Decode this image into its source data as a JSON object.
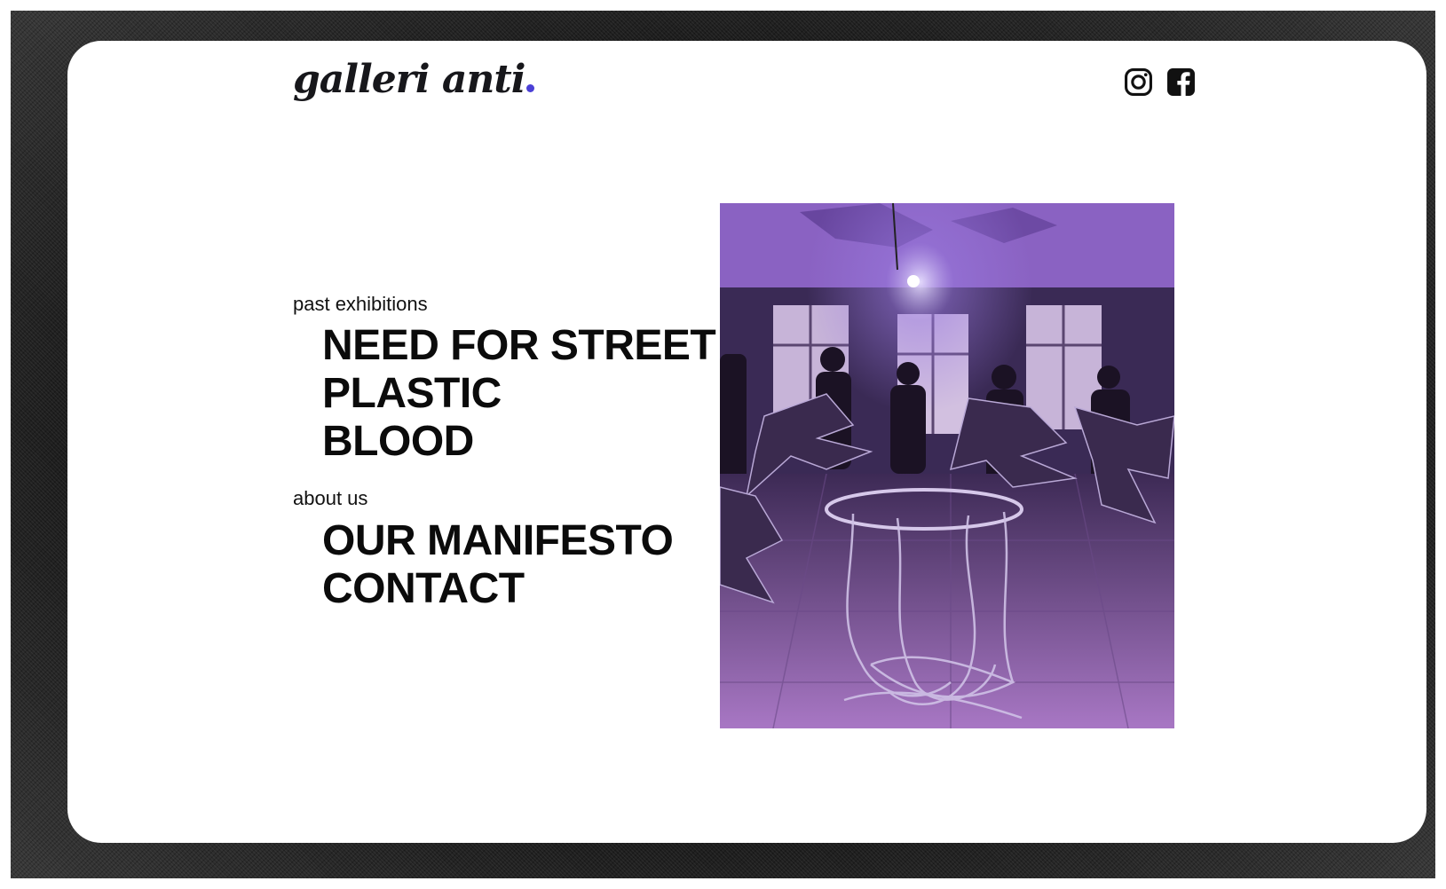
{
  "header": {
    "logo_text": "galleri anti",
    "social": [
      {
        "icon": "instagram-icon"
      },
      {
        "icon": "facebook-icon"
      }
    ]
  },
  "nav": {
    "past_exhibitions_label": "past exhibitions",
    "exhibitions": [
      "NEED FOR STREET",
      "PLASTIC",
      "BLOOD"
    ],
    "about_label": "about us",
    "about_links": [
      "OUR MANIFESTO",
      "CONTACT"
    ]
  },
  "hero_image": {
    "subject": "purple-lit gallery installation with metal sculptures and masked people"
  },
  "colors": {
    "accent": "#4b40d6",
    "text": "#0b0b0b",
    "background": "#ffffff",
    "photo_tint": "#7c4fb0"
  }
}
